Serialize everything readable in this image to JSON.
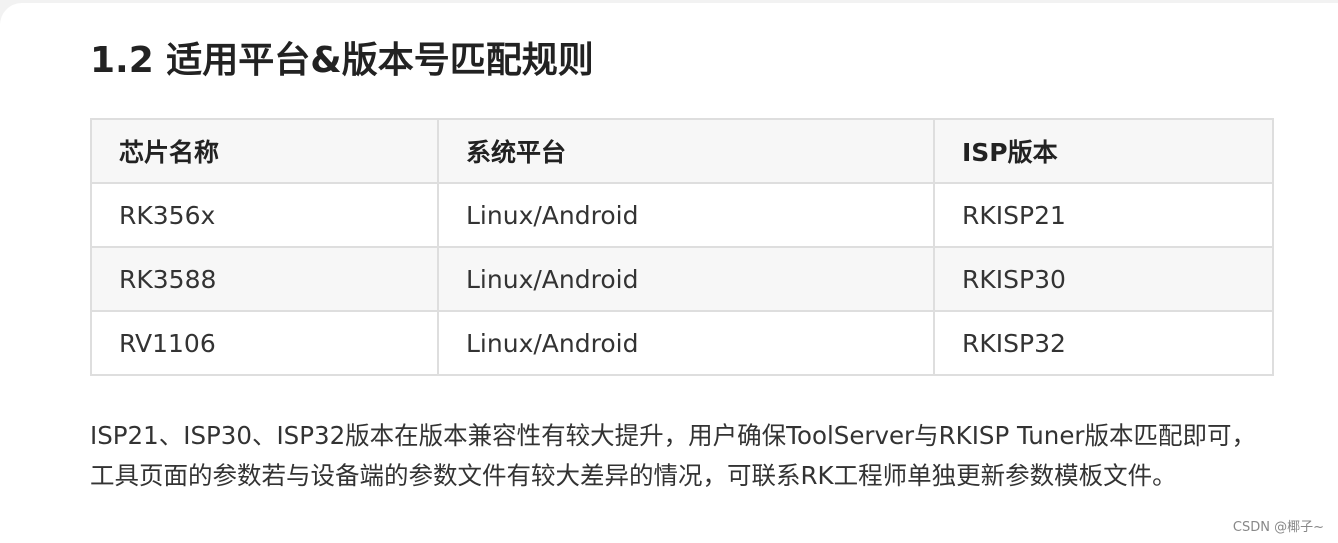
{
  "heading": "1.2 适用平台&版本号匹配规则",
  "table": {
    "headers": [
      "芯片名称",
      "系统平台",
      "ISP版本"
    ],
    "rows": [
      [
        "RK356x",
        "Linux/Android",
        "RKISP21"
      ],
      [
        "RK3588",
        "Linux/Android",
        "RKISP30"
      ],
      [
        "RV1106",
        "Linux/Android",
        "RKISP32"
      ]
    ]
  },
  "paragraph": "ISP21、ISP30、ISP32版本在版本兼容性有较大提升，用户确保ToolServer与RKISP Tuner版本匹配即可，工具页面的参数若与设备端的参数文件有较大差异的情况，可联系RK工程师单独更新参数模板文件。",
  "watermark": "CSDN @椰子~"
}
